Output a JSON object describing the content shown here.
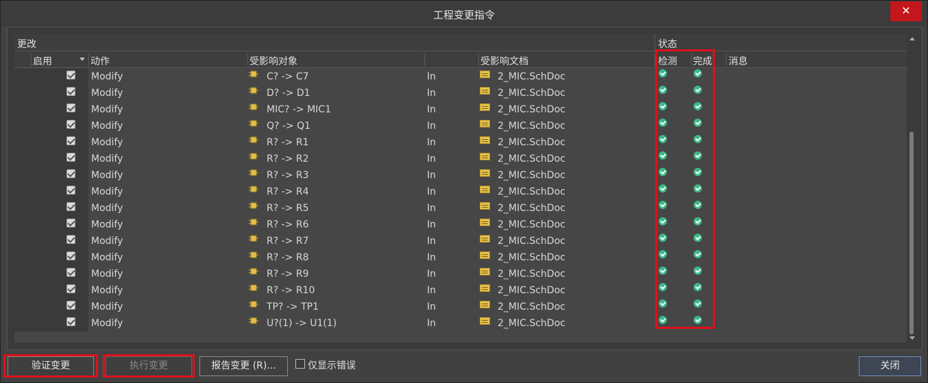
{
  "window": {
    "title": "工程变更指令",
    "close_glyph": "✕"
  },
  "grid": {
    "group_changes": "更改",
    "group_status": "状态",
    "columns": {
      "enable": "启用",
      "action": "动作",
      "affected_object": "受影响对象",
      "affected_document": "受影响文档",
      "check": "检测",
      "done": "完成",
      "message": "消息"
    },
    "rows": [
      {
        "enabled": true,
        "action": "Modify",
        "object": "C? -> C7",
        "dir": "In",
        "document": "2_MIC.SchDoc"
      },
      {
        "enabled": true,
        "action": "Modify",
        "object": "D? -> D1",
        "dir": "In",
        "document": "2_MIC.SchDoc"
      },
      {
        "enabled": true,
        "action": "Modify",
        "object": "MIC? -> MIC1",
        "dir": "In",
        "document": "2_MIC.SchDoc"
      },
      {
        "enabled": true,
        "action": "Modify",
        "object": "Q? -> Q1",
        "dir": "In",
        "document": "2_MIC.SchDoc"
      },
      {
        "enabled": true,
        "action": "Modify",
        "object": "R? -> R1",
        "dir": "In",
        "document": "2_MIC.SchDoc"
      },
      {
        "enabled": true,
        "action": "Modify",
        "object": "R? -> R2",
        "dir": "In",
        "document": "2_MIC.SchDoc"
      },
      {
        "enabled": true,
        "action": "Modify",
        "object": "R? -> R3",
        "dir": "In",
        "document": "2_MIC.SchDoc"
      },
      {
        "enabled": true,
        "action": "Modify",
        "object": "R? -> R4",
        "dir": "In",
        "document": "2_MIC.SchDoc"
      },
      {
        "enabled": true,
        "action": "Modify",
        "object": "R? -> R5",
        "dir": "In",
        "document": "2_MIC.SchDoc"
      },
      {
        "enabled": true,
        "action": "Modify",
        "object": "R? -> R6",
        "dir": "In",
        "document": "2_MIC.SchDoc"
      },
      {
        "enabled": true,
        "action": "Modify",
        "object": "R? -> R7",
        "dir": "In",
        "document": "2_MIC.SchDoc"
      },
      {
        "enabled": true,
        "action": "Modify",
        "object": "R? -> R8",
        "dir": "In",
        "document": "2_MIC.SchDoc"
      },
      {
        "enabled": true,
        "action": "Modify",
        "object": "R? -> R9",
        "dir": "In",
        "document": "2_MIC.SchDoc"
      },
      {
        "enabled": true,
        "action": "Modify",
        "object": "R? -> R10",
        "dir": "In",
        "document": "2_MIC.SchDoc"
      },
      {
        "enabled": true,
        "action": "Modify",
        "object": "TP? -> TP1",
        "dir": "In",
        "document": "2_MIC.SchDoc"
      },
      {
        "enabled": true,
        "action": "Modify",
        "object": "U?(1) -> U1(1)",
        "dir": "In",
        "document": "2_MIC.SchDoc"
      }
    ]
  },
  "buttons": {
    "validate": "验证变更",
    "execute": "执行变更",
    "report": "报告变更 (R)...",
    "close": "关闭"
  },
  "only_errors_label": "仅显示错误",
  "colors": {
    "highlight": "#e0101a",
    "ok": "#3fb888",
    "close_button": "#c4161c"
  },
  "icons": {
    "component": "component-icon",
    "document": "schematic-doc-icon",
    "status_ok": "check-circle-icon"
  }
}
